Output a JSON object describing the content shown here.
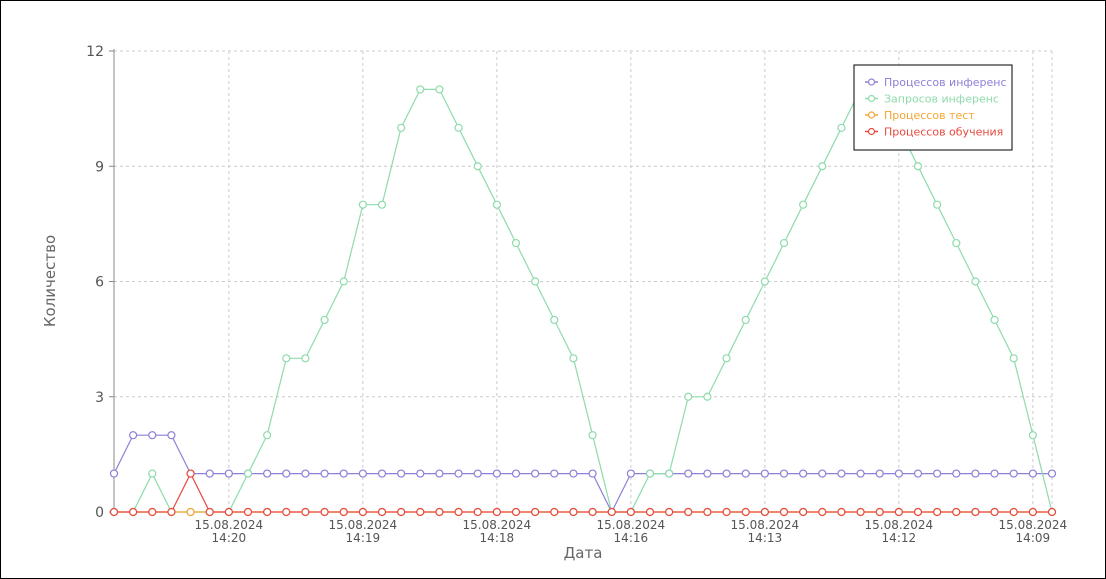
{
  "chart_data": {
    "type": "line",
    "xlabel": "Дата",
    "ylabel": "Количество",
    "ylim": [
      0,
      12
    ],
    "y_ticks": [
      0,
      3,
      6,
      9,
      12
    ],
    "grid": true,
    "legend_position": "top-right",
    "x_labels": [
      {
        "index": 6,
        "date": "15.08.2024",
        "time": "14:20"
      },
      {
        "index": 13,
        "date": "15.08.2024",
        "time": "14:19"
      },
      {
        "index": 20,
        "date": "15.08.2024",
        "time": "14:18"
      },
      {
        "index": 27,
        "date": "15.08.2024",
        "time": "14:16"
      },
      {
        "index": 34,
        "date": "15.08.2024",
        "time": "14:13"
      },
      {
        "index": 41,
        "date": "15.08.2024",
        "time": "14:12"
      },
      {
        "index": 48,
        "date": "15.08.2024",
        "time": "14:09"
      }
    ],
    "series": [
      {
        "name": "Процессов инференс",
        "color": "#8c80d8",
        "values": [
          1,
          2,
          2,
          2,
          1,
          1,
          1,
          1,
          1,
          1,
          1,
          1,
          1,
          1,
          1,
          1,
          1,
          1,
          1,
          1,
          1,
          1,
          1,
          1,
          1,
          1,
          0,
          1,
          1,
          1,
          1,
          1,
          1,
          1,
          1,
          1,
          1,
          1,
          1,
          1,
          1,
          1,
          1,
          1,
          1,
          1,
          1,
          1,
          1,
          1
        ]
      },
      {
        "name": "Запросов инференс",
        "color": "#8edbab",
        "values": [
          0,
          0,
          1,
          0,
          0,
          0,
          0,
          1,
          2,
          4,
          4,
          5,
          6,
          8,
          8,
          10,
          11,
          11,
          10,
          9,
          8,
          7,
          6,
          5,
          4,
          2,
          0,
          0,
          1,
          1,
          3,
          3,
          4,
          5,
          6,
          7,
          8,
          9,
          10,
          11,
          11,
          10,
          9,
          8,
          7,
          6,
          5,
          4,
          2,
          0
        ]
      },
      {
        "name": "Процессов тест",
        "color": "#f2a633",
        "values": [
          0,
          0,
          0,
          0,
          0,
          0,
          0,
          0,
          0,
          0,
          0,
          0,
          0,
          0,
          0,
          0,
          0,
          0,
          0,
          0,
          0,
          0,
          0,
          0,
          0,
          0,
          0,
          0,
          0,
          0,
          0,
          0,
          0,
          0,
          0,
          0,
          0,
          0,
          0,
          0,
          0,
          0,
          0,
          0,
          0,
          0,
          0,
          0,
          0,
          0
        ]
      },
      {
        "name": "Процессов обучения",
        "color": "#e84a3e",
        "values": [
          0,
          0,
          0,
          0,
          1,
          0,
          0,
          0,
          0,
          0,
          0,
          0,
          0,
          0,
          0,
          0,
          0,
          0,
          0,
          0,
          0,
          0,
          0,
          0,
          0,
          0,
          0,
          0,
          0,
          0,
          0,
          0,
          0,
          0,
          0,
          0,
          0,
          0,
          0,
          0,
          0,
          0,
          0,
          0,
          0,
          0,
          0,
          0,
          0,
          0
        ]
      }
    ]
  }
}
